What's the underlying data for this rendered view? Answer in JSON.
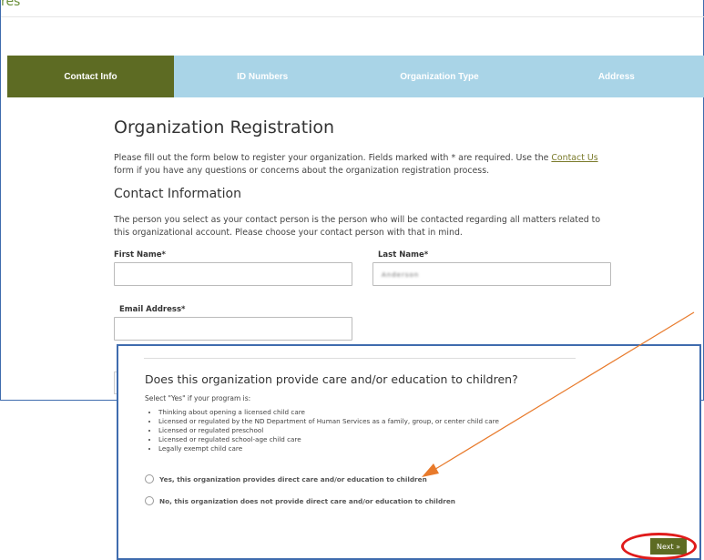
{
  "logo": {
    "text": "res"
  },
  "tabs": [
    {
      "label": "Contact Info",
      "active": true
    },
    {
      "label": "ID Numbers",
      "active": false
    },
    {
      "label": "Organization Type",
      "active": false
    },
    {
      "label": "Address",
      "active": false
    }
  ],
  "page": {
    "title": "Organization Registration",
    "intro_before_link": "Please fill out the form below to register your organization. Fields marked with * are required. Use the ",
    "intro_link": "Contact Us",
    "intro_after_link": " form if you have any questions or concerns about the organization registration process.",
    "section_title": "Contact Information",
    "section_text": "The person you select as your contact person is the person who will be contacted regarding all matters related to this organizational account. Please choose your contact person with that in mind."
  },
  "form": {
    "first_name_label": "First Name*",
    "first_name_value": "",
    "last_name_label": "Last Name*",
    "last_name_value": "Anderson",
    "email_label": "Email Address*",
    "email_value": ""
  },
  "care_question": {
    "question": "Does this organization provide care and/or education to children?",
    "select_hint": "Select \"Yes\" if your program is:",
    "bullets": [
      "Thinking about opening a licensed child care",
      "Licensed or regulated by the ND Department of Human Services as a family, group, or center child care",
      "Licensed or regulated preschool",
      "Licensed or regulated school-age child care",
      "Legally exempt child care"
    ],
    "yes_option": "Yes, this organization provides direct care and/or education to children",
    "no_option": "No, this organization does not provide direct care and/or education to children",
    "next_label": "Next »"
  },
  "colors": {
    "tab_active": "#5d6b23",
    "tab_inactive": "#a9d4e7",
    "frame_border": "#3f6cae",
    "annotation_arrow": "#e87a2b",
    "annotation_circle": "#e01b1b"
  }
}
